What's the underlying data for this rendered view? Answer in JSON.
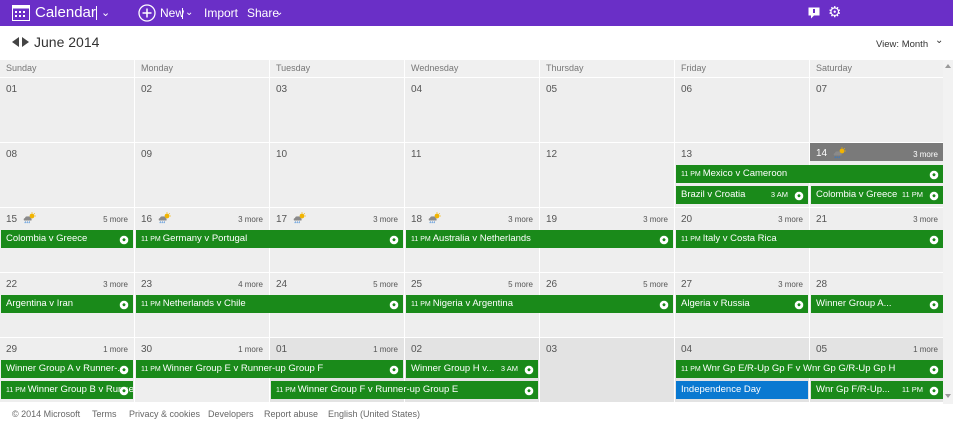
{
  "topbar": {
    "app_name": "Calendar",
    "new_label": "New",
    "import_label": "Import",
    "share_label": "Share"
  },
  "nav": {
    "month_title": "June 2014",
    "view_label": "View: Month"
  },
  "weekdays": [
    "Sunday",
    "Monday",
    "Tuesday",
    "Wednesday",
    "Thursday",
    "Friday",
    "Saturday"
  ],
  "cells": [
    {
      "num": "01",
      "more": "",
      "other": false
    },
    {
      "num": "02",
      "more": "",
      "other": false
    },
    {
      "num": "03",
      "more": "",
      "other": false
    },
    {
      "num": "04",
      "more": "",
      "other": false
    },
    {
      "num": "05",
      "more": "",
      "other": false
    },
    {
      "num": "06",
      "more": "",
      "other": false
    },
    {
      "num": "07",
      "more": "",
      "other": false
    },
    {
      "num": "08",
      "more": "",
      "other": false
    },
    {
      "num": "09",
      "more": "",
      "other": false
    },
    {
      "num": "10",
      "more": "",
      "other": false
    },
    {
      "num": "11",
      "more": "",
      "other": false
    },
    {
      "num": "12",
      "more": "",
      "other": false
    },
    {
      "num": "13",
      "more": "",
      "other": false
    },
    {
      "num": "14",
      "more": "3 more",
      "other": false,
      "today": true,
      "weather": true
    },
    {
      "num": "15",
      "more": "5 more",
      "other": false,
      "weather": true
    },
    {
      "num": "16",
      "more": "3 more",
      "other": false,
      "weather": true
    },
    {
      "num": "17",
      "more": "3 more",
      "other": false,
      "weather": true
    },
    {
      "num": "18",
      "more": "3 more",
      "other": false,
      "weather": true
    },
    {
      "num": "19",
      "more": "3 more",
      "other": false
    },
    {
      "num": "20",
      "more": "3 more",
      "other": false
    },
    {
      "num": "21",
      "more": "3 more",
      "other": false
    },
    {
      "num": "22",
      "more": "3 more",
      "other": false
    },
    {
      "num": "23",
      "more": "4 more",
      "other": false
    },
    {
      "num": "24",
      "more": "5 more",
      "other": false
    },
    {
      "num": "25",
      "more": "5 more",
      "other": false
    },
    {
      "num": "26",
      "more": "5 more",
      "other": false
    },
    {
      "num": "27",
      "more": "3 more",
      "other": false
    },
    {
      "num": "28",
      "more": "",
      "other": false
    },
    {
      "num": "29",
      "more": "1 more",
      "other": false
    },
    {
      "num": "30",
      "more": "1 more",
      "other": false
    },
    {
      "num": "01",
      "more": "1 more",
      "other": true
    },
    {
      "num": "02",
      "more": "",
      "other": true
    },
    {
      "num": "03",
      "more": "",
      "other": true
    },
    {
      "num": "04",
      "more": "",
      "other": true
    },
    {
      "num": "05",
      "more": "1 more",
      "other": true
    }
  ],
  "events": [
    {
      "row": 1,
      "col": 5,
      "span": 2,
      "slot": 0,
      "time": "11 PM",
      "title": "Mexico v Cameroon",
      "end": ""
    },
    {
      "row": 1,
      "col": 5,
      "span": 1,
      "slot": 1,
      "time": "",
      "title": "Brazil v Croatia",
      "end": "3 AM"
    },
    {
      "row": 1,
      "col": 6,
      "span": 1,
      "slot": 1,
      "time": "",
      "title": "Colombia v Greece",
      "end": "11 PM"
    },
    {
      "row": 2,
      "col": 0,
      "span": 1,
      "slot": 0,
      "time": "",
      "title": "Colombia v Greece",
      "end": ""
    },
    {
      "row": 2,
      "col": 1,
      "span": 2,
      "slot": 0,
      "time": "11 PM",
      "title": "Germany v Portugal",
      "end": ""
    },
    {
      "row": 2,
      "col": 3,
      "span": 2,
      "slot": 0,
      "time": "11 PM",
      "title": "Australia v Netherlands",
      "end": ""
    },
    {
      "row": 2,
      "col": 5,
      "span": 2,
      "slot": 0,
      "time": "11 PM",
      "title": "Italy v Costa Rica",
      "end": ""
    },
    {
      "row": 3,
      "col": 0,
      "span": 1,
      "slot": 0,
      "time": "",
      "title": "Argentina v Iran",
      "end": ""
    },
    {
      "row": 3,
      "col": 1,
      "span": 2,
      "slot": 0,
      "time": "11 PM",
      "title": "Netherlands v Chile",
      "end": ""
    },
    {
      "row": 3,
      "col": 3,
      "span": 2,
      "slot": 0,
      "time": "11 PM",
      "title": "Nigeria v Argentina",
      "end": ""
    },
    {
      "row": 3,
      "col": 5,
      "span": 1,
      "slot": 0,
      "time": "",
      "title": "Algeria v Russia",
      "end": ""
    },
    {
      "row": 3,
      "col": 6,
      "span": 1,
      "slot": 0,
      "time": "",
      "title": "Winner Group A...",
      "end": ""
    },
    {
      "row": 4,
      "col": 0,
      "span": 1,
      "slot": 0,
      "time": "",
      "title": "Winner Group A v Runner-...",
      "end": ""
    },
    {
      "row": 4,
      "col": 1,
      "span": 2,
      "slot": 0,
      "time": "11 PM",
      "title": "Winner Group E v Runner-up Group F",
      "end": ""
    },
    {
      "row": 4,
      "col": 3,
      "span": 1,
      "slot": 0,
      "time": "",
      "title": "Winner Group H v...",
      "end": "3 AM"
    },
    {
      "row": 4,
      "col": 0,
      "span": 1,
      "slot": 1,
      "time": "11 PM",
      "title": "Winner Group B v Runner-up Gp A",
      "end": ""
    },
    {
      "row": 4,
      "col": 2,
      "span": 2,
      "slot": 1,
      "time": "11 PM",
      "title": "Winner Group F v Runner-up Group E",
      "end": ""
    },
    {
      "row": 4,
      "col": 5,
      "span": 2,
      "slot": 0,
      "time": "11 PM",
      "title": "Wnr Gp E/R-Up Gp F v Wnr Gp G/R-Up Gp H",
      "end": ""
    },
    {
      "row": 4,
      "col": 5,
      "span": 1,
      "slot": 1,
      "time": "",
      "title": "Independence Day",
      "end": "",
      "blue": true
    },
    {
      "row": 4,
      "col": 6,
      "span": 1,
      "slot": 1,
      "time": "",
      "title": "Wnr Gp F/R-Up...",
      "end": "11 PM"
    }
  ],
  "footer": [
    "© 2014 Microsoft",
    "Terms",
    "Privacy & cookies",
    "Developers",
    "Report abuse",
    "English (United States)"
  ]
}
